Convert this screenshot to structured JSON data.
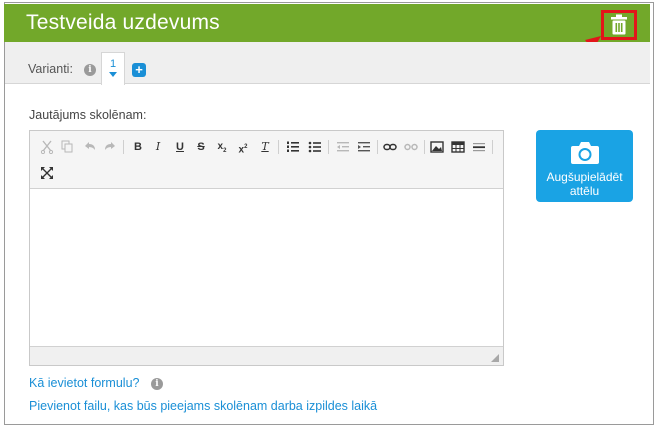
{
  "header": {
    "title": "Testveida uzdevums",
    "color": "#72a82a",
    "delete_icon": "trash-icon"
  },
  "annotation": {
    "highlight_color": "#e3151a"
  },
  "variants": {
    "label": "Varianti:",
    "tabs": [
      {
        "label": "1",
        "active": true
      }
    ],
    "add_label": "+"
  },
  "question": {
    "label": "Jautājums skolēnam:",
    "value": ""
  },
  "editor": {
    "toolbar_icons": [
      "cut-icon",
      "copy-icon",
      "undo-icon",
      "redo-icon",
      "bold-icon",
      "italic-icon",
      "underline-icon",
      "strikethrough-icon",
      "subscript-icon",
      "superscript-icon",
      "remove-format-icon",
      "numbered-list-icon",
      "bulleted-list-icon",
      "outdent-icon",
      "indent-icon",
      "link-icon",
      "unlink-icon",
      "image-icon",
      "table-icon",
      "horizontal-rule-icon",
      "maximize-icon"
    ]
  },
  "upload": {
    "line1": "Augšupielādēt",
    "line2": "attēlu",
    "icon": "camera-icon",
    "color": "#1aa3e4"
  },
  "links": {
    "formula": "Kā ievietot formulu?",
    "attach": "Pievienot failu, kas būs pieejams skolēnam darba izpildes laikā"
  }
}
